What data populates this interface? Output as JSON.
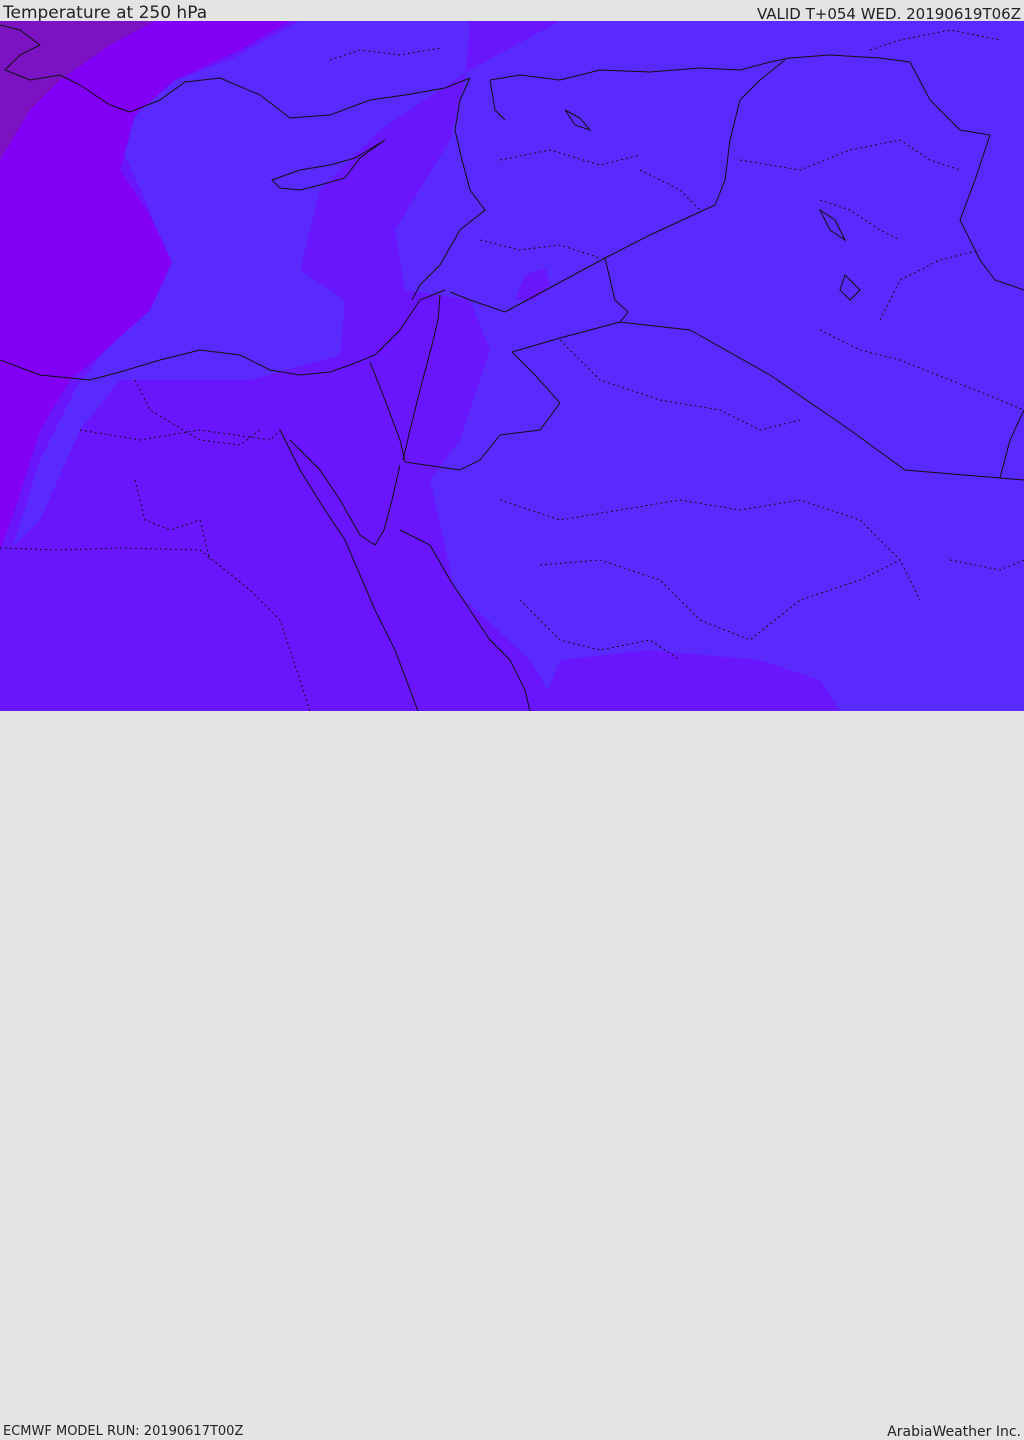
{
  "header": {
    "title": "Temperature at 250 hPa",
    "valid": "VALID T+054 WED. 20190619T06Z"
  },
  "footer": {
    "model_run": "ECMWF MODEL RUN: 20190617T00Z",
    "credit": "ArabiaWeather Inc."
  },
  "colors": {
    "band_coldest": "#7a16b8",
    "band_cold": "#8100f5",
    "band_mid": "#6a16fd",
    "band_warm": "#5a2afc",
    "borders": "#111111"
  }
}
